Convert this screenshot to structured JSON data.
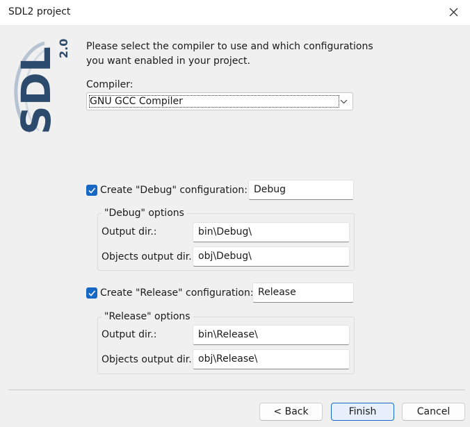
{
  "window": {
    "title": "SDL2 project"
  },
  "logo": {
    "text": "SDL",
    "version": "2.0"
  },
  "intro": {
    "line1": "Please select the compiler to use and which configurations",
    "line2": "you want enabled in your project."
  },
  "compiler": {
    "label": "Compiler:",
    "value": "GNU GCC Compiler"
  },
  "debug": {
    "checkbox_label": "Create \"Debug\" configuration:",
    "checked": true,
    "name": "Debug",
    "group_title": "\"Debug\" options",
    "output_dir_label": "Output dir.:",
    "output_dir": "bin\\Debug\\",
    "objects_dir_label": "Objects output dir.:",
    "objects_dir": "obj\\Debug\\"
  },
  "release": {
    "checkbox_label": "Create \"Release\" configuration:",
    "checked": true,
    "name": "Release",
    "group_title": "\"Release\" options",
    "output_dir_label": "Output dir.:",
    "output_dir": "bin\\Release\\",
    "objects_dir_label": "Objects output dir.:",
    "objects_dir": "obj\\Release\\"
  },
  "buttons": {
    "back": "< Back",
    "finish": "Finish",
    "cancel": "Cancel"
  },
  "colors": {
    "accent": "#1668c4",
    "logo": "#2c4a6b"
  }
}
